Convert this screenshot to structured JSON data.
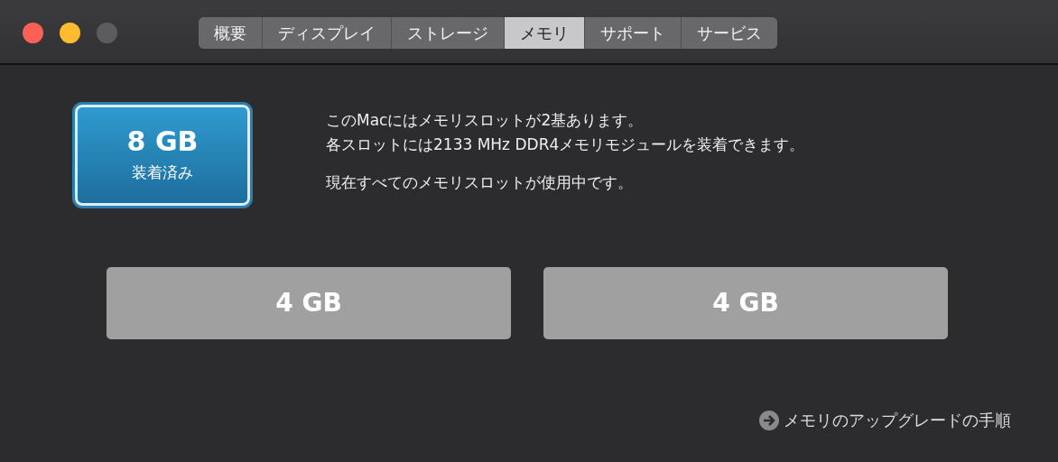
{
  "tabs": [
    {
      "label": "概要",
      "selected": false
    },
    {
      "label": "ディスプレイ",
      "selected": false
    },
    {
      "label": "ストレージ",
      "selected": false
    },
    {
      "label": "メモリ",
      "selected": true
    },
    {
      "label": "サポート",
      "selected": false
    },
    {
      "label": "サービス",
      "selected": false
    }
  ],
  "installed": {
    "size": "8 GB",
    "label": "装着済み"
  },
  "description": [
    "このMacにはメモリスロットが2基あります。",
    "各スロットには2133 MHz DDR4メモリモジュールを装着できます。",
    "現在すべてのメモリスロットが使用中です。"
  ],
  "slots": [
    {
      "size": "4 GB"
    },
    {
      "size": "4 GB"
    }
  ],
  "upgrade_link": "メモリのアップグレードの手順"
}
